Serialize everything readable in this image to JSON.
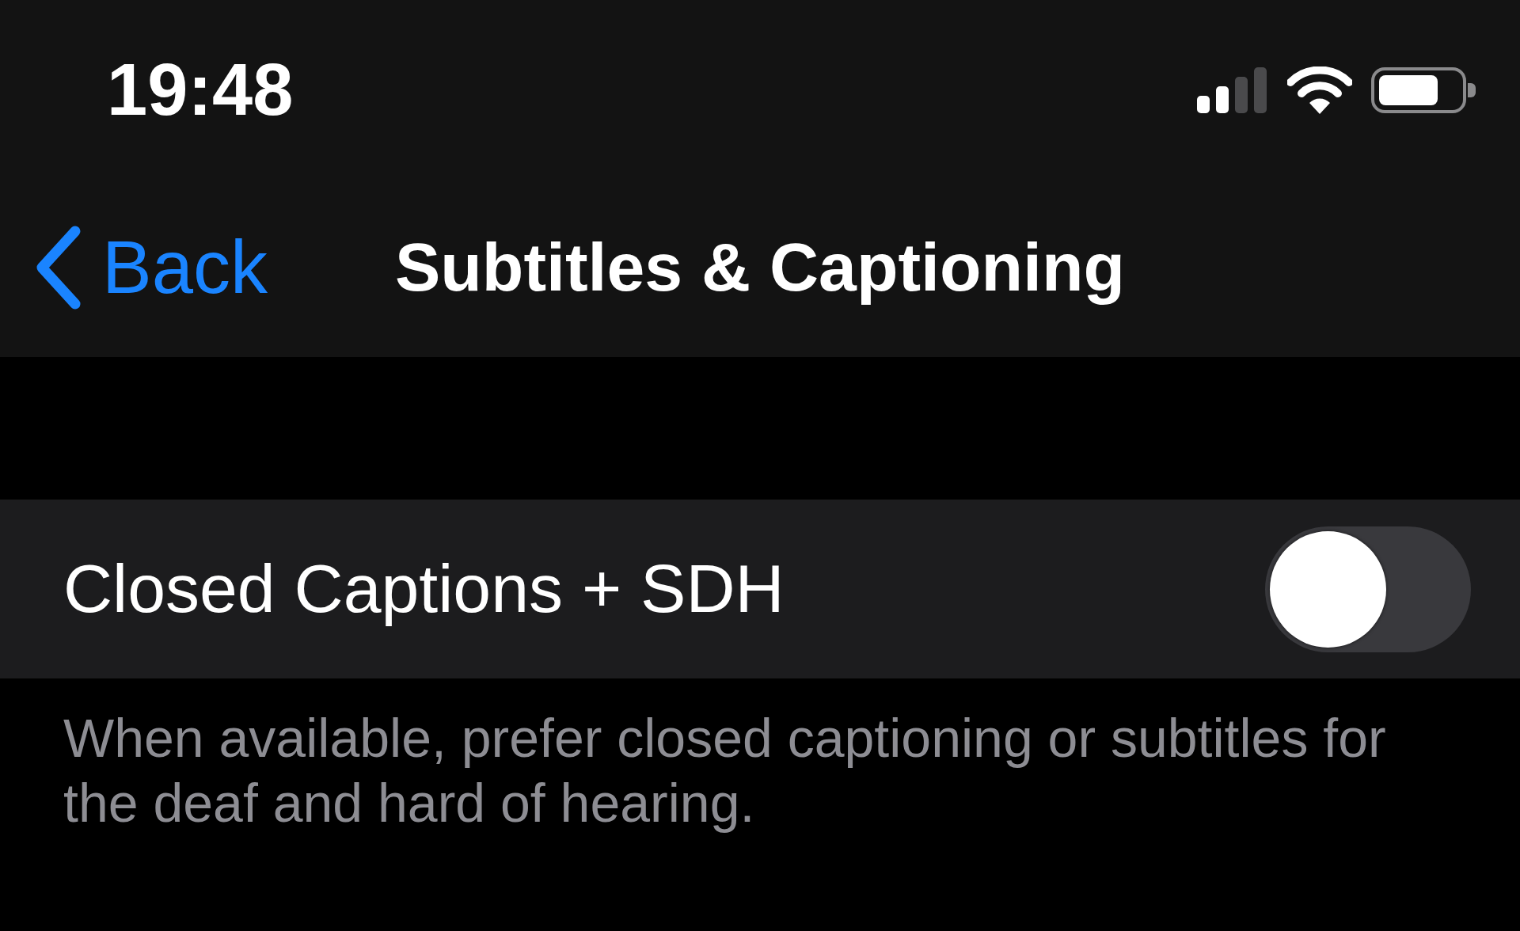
{
  "status_bar": {
    "time": "19:48"
  },
  "nav_bar": {
    "back_label": "Back",
    "title": "Subtitles & Captioning"
  },
  "section": {
    "rows": [
      {
        "label": "Closed Captions + SDH",
        "on": false
      }
    ],
    "footer": "When available, prefer closed captioning or subtitles for the deaf and hard of hearing."
  }
}
